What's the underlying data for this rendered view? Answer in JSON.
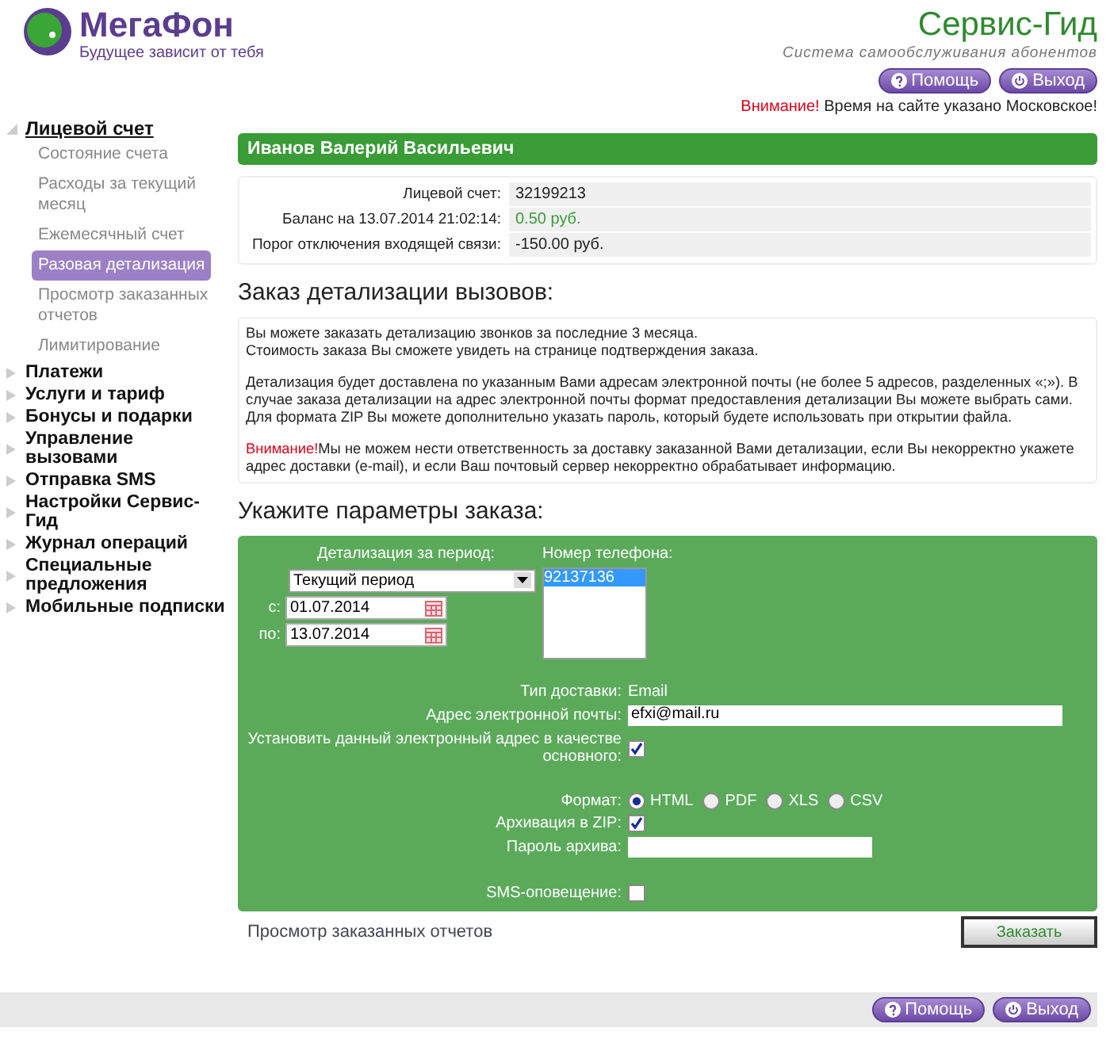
{
  "header": {
    "logo_text": "МегаФон",
    "slogan": "Будущее зависит от тебя",
    "service_title": "Сервис-Гид",
    "service_subtitle": "Система самообслуживания абонентов",
    "buttons": [
      {
        "label": "Помощь",
        "kind": "help"
      },
      {
        "label": "Выход",
        "kind": "exit"
      }
    ],
    "notice_label": "Внимание!",
    "notice_text": "Время на сайте указано Московское!"
  },
  "sidebar": {
    "items": [
      {
        "label": "Лицевой счет",
        "expanded": true,
        "children": [
          {
            "label": "Состояние счета",
            "selected": false
          },
          {
            "label": "Расходы за текущий месяц",
            "selected": false
          },
          {
            "label": "Ежемесячный счет",
            "selected": false
          },
          {
            "label": "Разовая детализация",
            "selected": true
          },
          {
            "label": "Просмотр заказанных отчетов",
            "selected": false
          },
          {
            "label": "Лимитирование",
            "selected": false
          }
        ]
      },
      {
        "label": "Платежи",
        "expanded": false
      },
      {
        "label": "Услуги и тариф",
        "expanded": false
      },
      {
        "label": "Бонусы и подарки",
        "expanded": false
      },
      {
        "label": "Управление вызовами",
        "expanded": false
      },
      {
        "label": "Отправка SMS",
        "expanded": false
      },
      {
        "label": "Настройки Сервис-Гид",
        "expanded": false
      },
      {
        "label": "Журнал операций",
        "expanded": false
      },
      {
        "label": "Специальные предложения",
        "expanded": false
      },
      {
        "label": "Мобильные подписки",
        "expanded": false
      }
    ]
  },
  "subscriber_name": "Иванов Валерий Васильевич",
  "account_info": [
    {
      "label": "Лицевой счет:",
      "value": "32199213",
      "kind": "plain"
    },
    {
      "label": "Баланс на 13.07.2014 21:02:14:",
      "value": "0.50 руб.",
      "kind": "positive"
    },
    {
      "label": "Порог отключения входящей связи:",
      "value": "-150.00 руб.",
      "kind": "plain"
    }
  ],
  "order_heading": "Заказ детализации вызовов:",
  "order_notice": [
    {
      "lines": [
        "Вы можете заказать детализацию звонков за последние 3 месяца.",
        "Стоимость заказа Вы сможете увидеть на странице подтверждения заказа."
      ]
    },
    {
      "lines": [
        "Детализация будет доставлена по указанным Вами адресам электронной почты (не более 5 адресов, разделенных «;»). В случае заказа детализации на адрес электронной почты формат предоставления детализации Вы можете выбрать сами. Для формата ZIP Вы можете дополнительно указать пароль, который будете использовать при открытии файла."
      ]
    },
    {
      "warning_label": "Внимание!",
      "lines": [
        "Мы не можем нести ответственность за доставку заказанной Вами детализации, если Вы некорректно укажете адрес доставки (e-mail), и если Ваш почтовый сервер некорректно обрабатывает информацию."
      ]
    }
  ],
  "params_heading": "Укажите параметры заказа:",
  "form": {
    "period_label": "Детализация за период:",
    "period_value": "Текущий период",
    "from_label": "с:",
    "from_date": "01.07.2014",
    "to_label": "по:",
    "to_date": "13.07.2014",
    "phone_label": "Номер телефона:",
    "phones": [
      {
        "number": "92137136",
        "selected": true
      }
    ],
    "delivery_type_label": "Тип доставки:",
    "delivery_type": "Email",
    "email_label": "Адрес электронной почты:",
    "email_value": "efxi@mail.ru",
    "set_primary_label": "Установить данный электронный адрес в качестве основного:",
    "set_primary_checked": true,
    "format_label": "Формат:",
    "formats": [
      {
        "label": "HTML",
        "selected": true
      },
      {
        "label": "PDF",
        "selected": false
      },
      {
        "label": "XLS",
        "selected": false
      },
      {
        "label": "CSV",
        "selected": false
      }
    ],
    "zip_label": "Архивация в ZIP:",
    "zip_checked": true,
    "password_label": "Пароль архива:",
    "sms_label": "SMS-оповещение:",
    "sms_checked": false
  },
  "view_reports_link": "Просмотр заказанных отчетов",
  "order_button": "Заказать",
  "footer_buttons": [
    {
      "label": "Помощь",
      "kind": "help"
    },
    {
      "label": "Выход",
      "kind": "exit"
    }
  ]
}
